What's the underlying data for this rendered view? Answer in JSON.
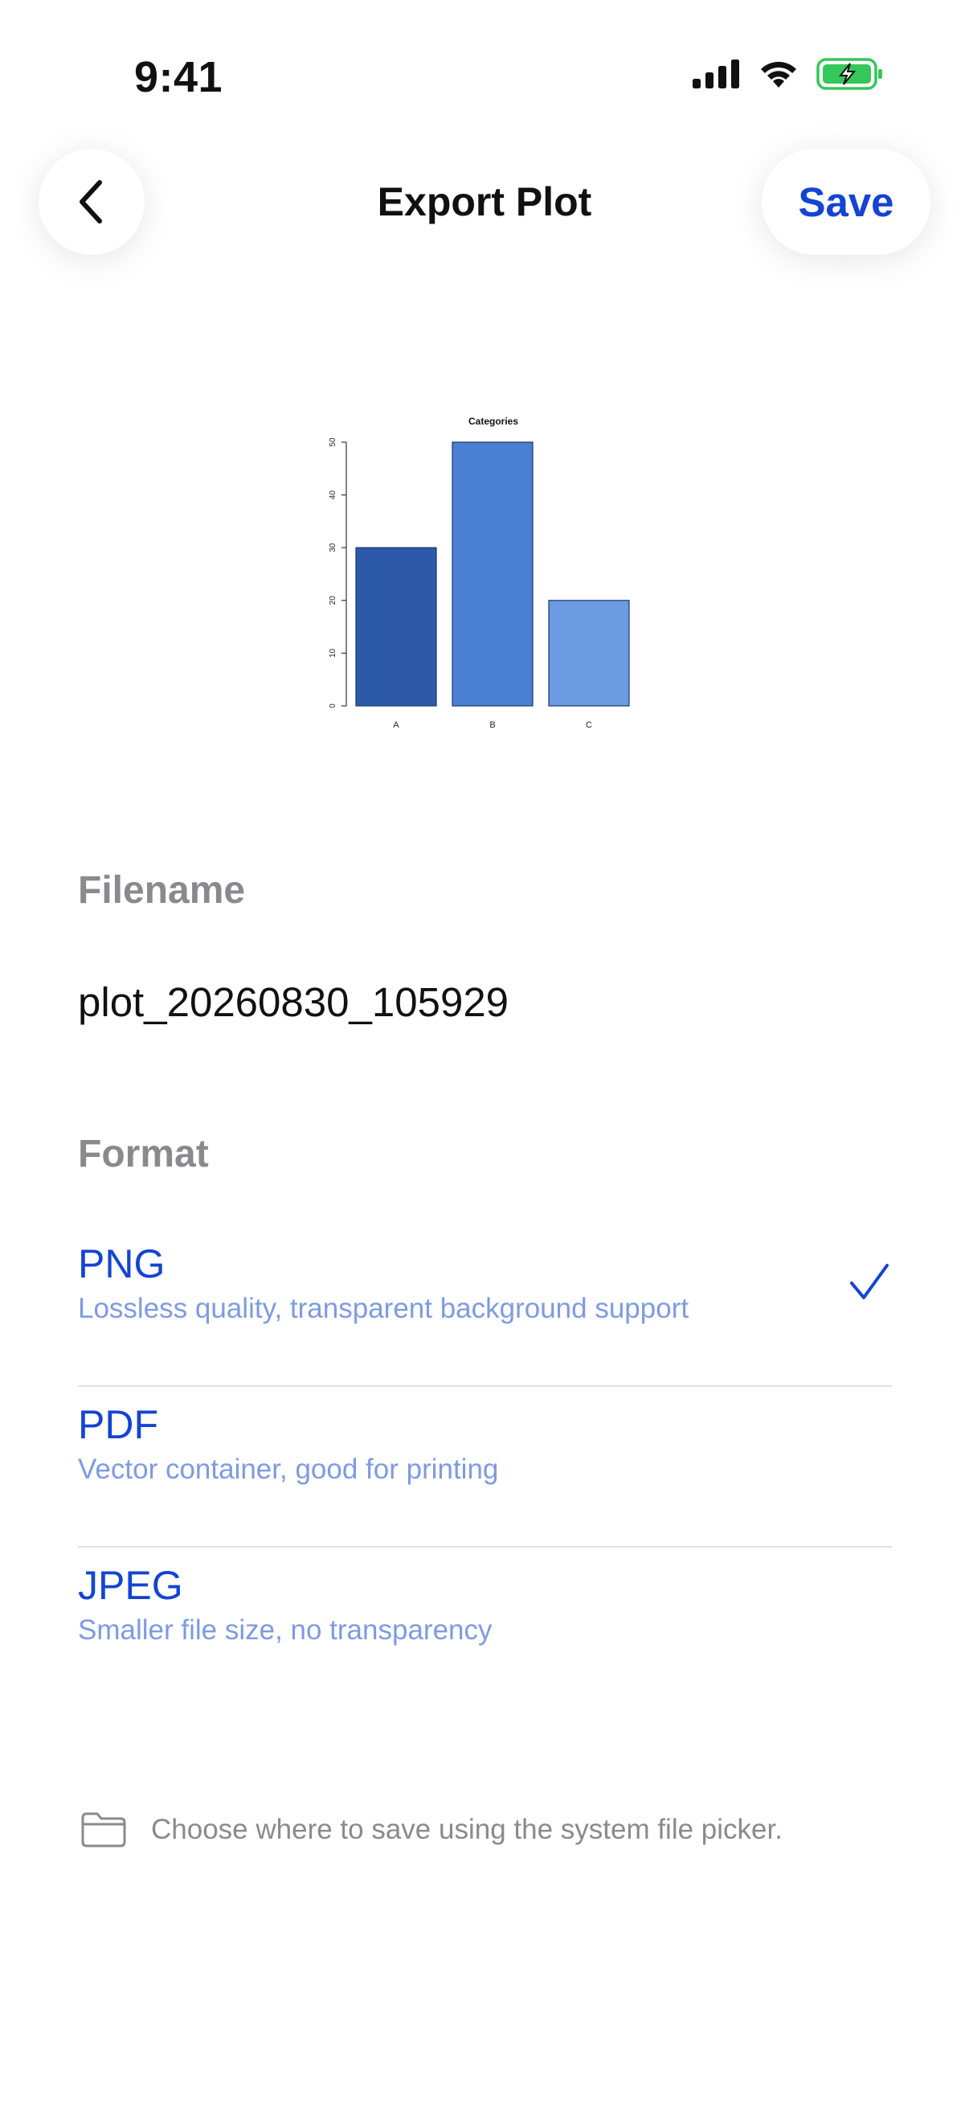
{
  "status_bar": {
    "time": "9:41"
  },
  "header": {
    "title": "Export Plot",
    "save_label": "Save"
  },
  "chart_data": {
    "type": "bar",
    "title": "Categories",
    "categories": [
      "A",
      "B",
      "C"
    ],
    "values": [
      30,
      50,
      20
    ],
    "colors": [
      "#2c5aa8",
      "#4a7fd3",
      "#6a9be3"
    ],
    "yticks": [
      "0",
      "10",
      "20",
      "30",
      "40",
      "50"
    ],
    "ylim": [
      0,
      50
    ],
    "grid": false
  },
  "filename": {
    "label": "Filename",
    "value": "plot_20260830_105929"
  },
  "format": {
    "label": "Format",
    "options": [
      {
        "name": "PNG",
        "description": "Lossless quality, transparent background support",
        "selected": true
      },
      {
        "name": "PDF",
        "description": "Vector container, good for printing",
        "selected": false
      },
      {
        "name": "JPEG",
        "description": "Smaller file size, no transparency",
        "selected": false
      }
    ]
  },
  "footer": {
    "note": "Choose where to save using the system file picker."
  },
  "colors": {
    "accent": "#1444d2",
    "secondary_text": "#8a8a8e",
    "option_description": "#7e9be0",
    "battery": "#34c759"
  },
  "icons": {
    "back": "chevron-left-icon",
    "check": "checkmark-icon",
    "folder": "folder-icon"
  }
}
